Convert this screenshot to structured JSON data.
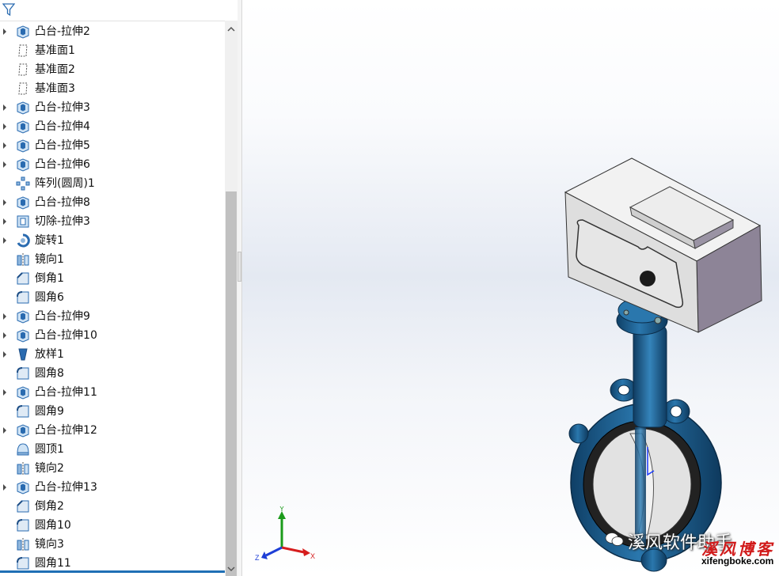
{
  "tree": {
    "items": [
      {
        "label": "凸台-拉伸2",
        "icon": "extrude-icon",
        "expandable": true
      },
      {
        "label": "基准面1",
        "icon": "plane-icon",
        "expandable": false
      },
      {
        "label": "基准面2",
        "icon": "plane-icon",
        "expandable": false
      },
      {
        "label": "基准面3",
        "icon": "plane-icon",
        "expandable": false
      },
      {
        "label": "凸台-拉伸3",
        "icon": "extrude-icon",
        "expandable": true
      },
      {
        "label": "凸台-拉伸4",
        "icon": "extrude-icon",
        "expandable": true
      },
      {
        "label": "凸台-拉伸5",
        "icon": "extrude-icon",
        "expandable": true
      },
      {
        "label": "凸台-拉伸6",
        "icon": "extrude-icon",
        "expandable": true
      },
      {
        "label": "阵列(圆周)1",
        "icon": "circular-pattern-icon",
        "expandable": false
      },
      {
        "label": "凸台-拉伸8",
        "icon": "extrude-icon",
        "expandable": true
      },
      {
        "label": "切除-拉伸3",
        "icon": "cut-extrude-icon",
        "expandable": true
      },
      {
        "label": "旋转1",
        "icon": "revolve-icon",
        "expandable": true
      },
      {
        "label": "镜向1",
        "icon": "mirror-icon",
        "expandable": false
      },
      {
        "label": "倒角1",
        "icon": "chamfer-icon",
        "expandable": false
      },
      {
        "label": "圆角6",
        "icon": "fillet-icon",
        "expandable": false
      },
      {
        "label": "凸台-拉伸9",
        "icon": "extrude-icon",
        "expandable": true
      },
      {
        "label": "凸台-拉伸10",
        "icon": "extrude-icon",
        "expandable": true
      },
      {
        "label": "放样1",
        "icon": "loft-icon",
        "expandable": true
      },
      {
        "label": "圆角8",
        "icon": "fillet-icon",
        "expandable": false
      },
      {
        "label": "凸台-拉伸11",
        "icon": "extrude-icon",
        "expandable": true
      },
      {
        "label": "圆角9",
        "icon": "fillet-icon",
        "expandable": false
      },
      {
        "label": "凸台-拉伸12",
        "icon": "extrude-icon",
        "expandable": true
      },
      {
        "label": "圆顶1",
        "icon": "dome-icon",
        "expandable": false
      },
      {
        "label": "镜向2",
        "icon": "mirror-icon",
        "expandable": false
      },
      {
        "label": "凸台-拉伸13",
        "icon": "extrude-icon",
        "expandable": true
      },
      {
        "label": "倒角2",
        "icon": "chamfer-icon",
        "expandable": false
      },
      {
        "label": "圆角10",
        "icon": "fillet-icon",
        "expandable": false
      },
      {
        "label": "镜向3",
        "icon": "mirror-icon",
        "expandable": false
      },
      {
        "label": "圆角11",
        "icon": "fillet-icon",
        "expandable": false
      }
    ]
  },
  "triad": {
    "x": "X",
    "y": "Y",
    "z": "Z"
  },
  "watermark": {
    "text": "溪风软件助手",
    "blog_cn": "溪风博客",
    "blog_url": "xifengboke.com"
  },
  "colors": {
    "valve_body": "#1d5f8e",
    "actuator": "#d9d9d9",
    "selection": "#1f6fb5"
  }
}
